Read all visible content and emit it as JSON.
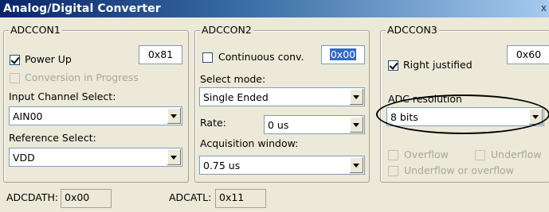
{
  "window": {
    "title": "Analog/Digital Converter",
    "close_label": "x"
  },
  "adccon1": {
    "legend": "ADCCON1",
    "hex": "0x81",
    "power_up": {
      "label": "Power Up",
      "checked": true
    },
    "conversion": {
      "label": "Conversion in Progress",
      "checked": false,
      "disabled": true
    },
    "input_channel_label": "Input Channel Select:",
    "input_channel_value": "AIN00",
    "reference_label": "Reference Select:",
    "reference_value": "VDD"
  },
  "adccon2": {
    "legend": "ADCCON2",
    "continuous": {
      "label": "Continuous conv.",
      "checked": false
    },
    "hex": "0x00",
    "select_mode_label": "Select mode:",
    "select_mode_value": "Single Ended",
    "rate_label": "Rate:",
    "rate_value": "0 us",
    "acquisition_label": "Acquisition window:",
    "acquisition_value": "0.75 us"
  },
  "adccon3": {
    "legend": "ADCCON3",
    "right_justified": {
      "label": "Right justified",
      "checked": true
    },
    "hex": "0x60",
    "resolution_label": "ADC resolution",
    "resolution_value": "8 bits",
    "overflow_label": "Overflow",
    "underflow_label": "Underflow",
    "under_or_over_label": "Underflow or overflow"
  },
  "status": {
    "adcdath_label": "ADCDATH:",
    "adcdath_value": "0x00",
    "adcatl_label": "ADCATL:",
    "adcatl_value": "0x11"
  }
}
